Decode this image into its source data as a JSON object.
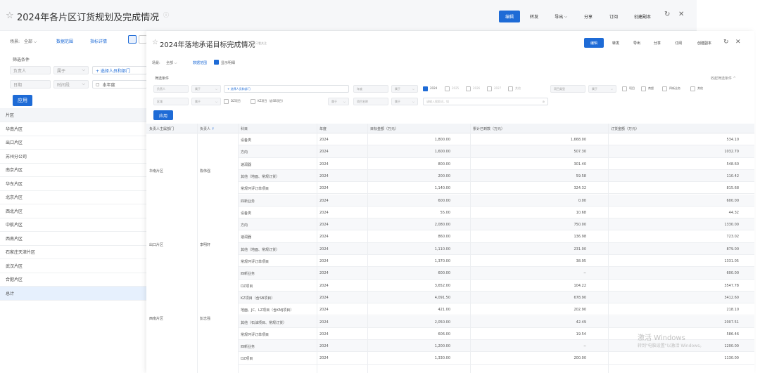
{
  "back_window": {
    "title": "2024年各片区订货规划及完成情况",
    "subtitle": "只看关注",
    "buttons": [
      "编辑",
      "转发",
      "导出",
      "分享",
      "订阅",
      "创建副本"
    ],
    "tab_label": "场景:",
    "tab_value": "全部",
    "tab_link1": "数据范围",
    "tab_link2": "指标详情",
    "filter_title": "筛选条件",
    "filter_person_placeholder": "负责人",
    "filter_person_op": "属于",
    "filter_dept_value": "+ 选择人员和部门",
    "filter_date_label": "日期",
    "filter_date_op": "时间段",
    "filter_fiscal_label": "本年度",
    "apply": "应用",
    "column_header": "片区",
    "regions": [
      "华南片区",
      "出口片区",
      "苏州分公司",
      "南京片区",
      "华东片区",
      "北京片区",
      "西北片区",
      "中航片区",
      "西南片区",
      "石家庄天津片区",
      "武汉片区",
      "合肥片区",
      "总计"
    ]
  },
  "front_window": {
    "title": "2024年落地承诺目标完成情况",
    "subtitle": "只看关注",
    "buttons": [
      "编辑",
      "转发",
      "导出",
      "分享",
      "订阅",
      "创建副本"
    ],
    "tab_label": "场景:",
    "tab_value": "全部",
    "tab_link1": "数据范围",
    "tab_link2": "显示明细",
    "filter_title": "筛选条件",
    "collapse": "收起筛选条件 ^",
    "f_person": "负责人",
    "f_op_in": "属于",
    "f_dept_value": "+ 选择人员和部门",
    "f_year": "年度",
    "f_year_op": "属于",
    "years": [
      "2024",
      "2025",
      "2026",
      "2027",
      "其他"
    ],
    "f_type": "项目类型",
    "f_type_op": "属于",
    "types": [
      "项目",
      "商超",
      "四新业务",
      "其他"
    ],
    "f_row2_a": "区域",
    "f_row2_a_op": "属于",
    "f_chk_a": "DZ项目",
    "f_chk_b": "KZ项目（含SB项目）",
    "f_row2_b_op": "属于",
    "f_row2_c": "项目名称",
    "f_row2_c_op": "属于",
    "f_search_ph": "请输入搜索词，如",
    "apply": "应用",
    "headers": [
      "负责人主属部门",
      "负责人",
      "科目",
      "年度",
      "目标金额（万元）",
      "累计已到款（万元）",
      "订货金额（万元）"
    ],
    "groups": [
      {
        "dept": "华南片区",
        "person": "陈伟强"
      },
      {
        "dept": "出口片区",
        "person": "李明轩"
      },
      {
        "dept": "西南片区",
        "person": "彭志强"
      }
    ],
    "rows": [
      {
        "item": "设备类",
        "year": "2024",
        "target": "1,800.00",
        "paid": "1,668.00",
        "order": "534.10"
      },
      {
        "item": "方向",
        "year": "2024",
        "target": "1,600.00",
        "paid": "507.30",
        "order": "1032.70"
      },
      {
        "item": "速润器",
        "year": "2024",
        "target": "800.00",
        "paid": "301.40",
        "order": "548.60"
      },
      {
        "item": "其他（地面、常规订货）",
        "year": "2024",
        "target": "200.00",
        "paid": "59.58",
        "order": "110.42"
      },
      {
        "item": "常规环评订单项目",
        "year": "2024",
        "target": "1,140.00",
        "paid": "324.32",
        "order": "815.68"
      },
      {
        "item": "四新业务",
        "year": "2024",
        "target": "600.00",
        "paid": "0.00",
        "order": "600.00"
      },
      {
        "item": "设备类",
        "year": "2024",
        "target": "55.00",
        "paid": "10.68",
        "order": "44.32"
      },
      {
        "item": "方向",
        "year": "2024",
        "target": "2,080.00",
        "paid": "750.00",
        "order": "1330.00"
      },
      {
        "item": "速润器",
        "year": "2024",
        "target": "860.00",
        "paid": "136.98",
        "order": "723.02"
      },
      {
        "item": "其他（地面、常规订货）",
        "year": "2024",
        "target": "1,110.00",
        "paid": "231.00",
        "order": "879.00"
      },
      {
        "item": "常规环评订单项目",
        "year": "2024",
        "target": "1,370.00",
        "paid": "38.95",
        "order": "1331.05"
      },
      {
        "item": "四新业务",
        "year": "2024",
        "target": "600.00",
        "paid": "--",
        "order": "600.00"
      },
      {
        "item": "DZ项目",
        "year": "2024",
        "target": "3,652.00",
        "paid": "104.22",
        "order": "3547.78"
      },
      {
        "item": "KZ项目（含SB项目）",
        "year": "2024",
        "target": "4,091.50",
        "paid": "678.90",
        "order": "3412.60"
      },
      {
        "item": "地面、JC、LZ项目（含KMJ项目）",
        "year": "2024",
        "target": "421.00",
        "paid": "202.90",
        "order": "218.10"
      },
      {
        "item": "其他（石油项目、常规订货）",
        "year": "2024",
        "target": "2,050.00",
        "paid": "42.49",
        "order": "2007.51"
      },
      {
        "item": "常规环评订单项目",
        "year": "2024",
        "target": "606.00",
        "paid": "19.54",
        "order": "586.46"
      },
      {
        "item": "四新业务",
        "year": "2024",
        "target": "1,200.00",
        "paid": "--",
        "order": "1200.00"
      },
      {
        "item": "DZ项目",
        "year": "2024",
        "target": "1,330.00",
        "paid": "200.00",
        "order": "1130.00"
      }
    ]
  },
  "watermark": {
    "line1": "激活 Windows",
    "line2": "转到\"电脑设置\"以激活 Windows。"
  }
}
